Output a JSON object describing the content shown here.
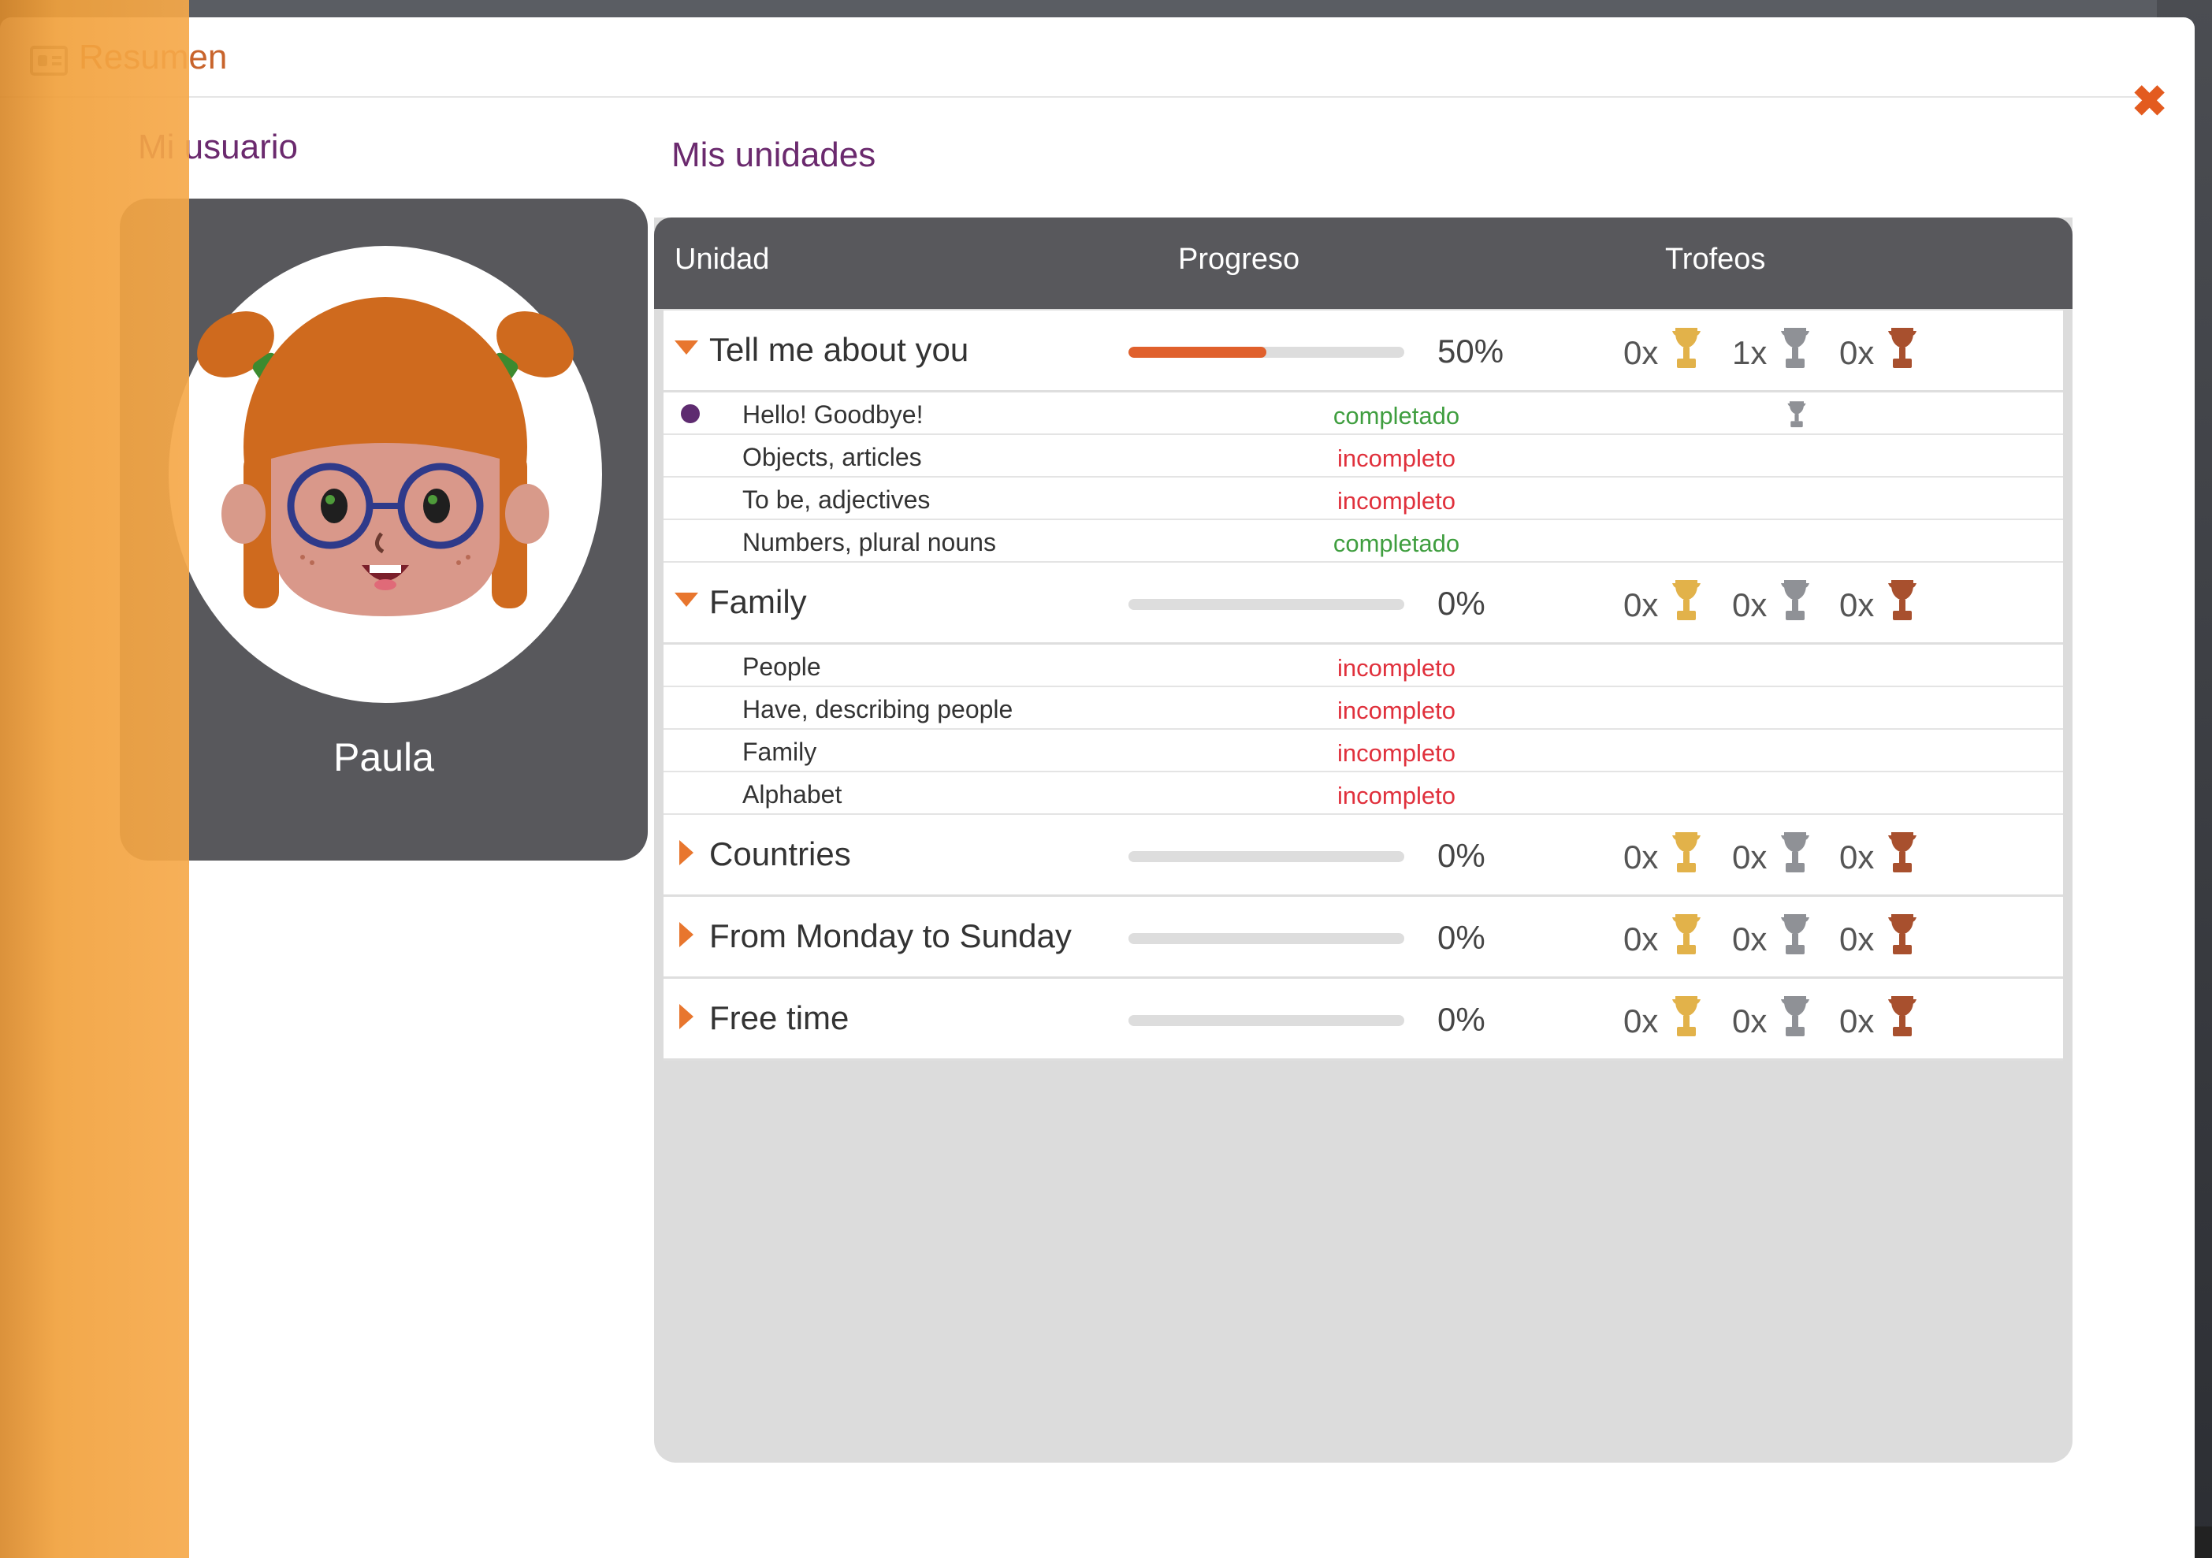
{
  "window": {
    "title": "Resumen",
    "close_symbol": "✖"
  },
  "user_section": {
    "title": "Mi usuario",
    "name": "Paula"
  },
  "units_section": {
    "title": "Mis unidades",
    "columns": {
      "unit": "Unidad",
      "progress": "Progreso",
      "trophies": "Trofeos"
    },
    "units": [
      {
        "name": "Tell me about you",
        "expanded": true,
        "progress": 50,
        "progress_label": "50%",
        "trophies": {
          "gold": "0x",
          "silver": "1x",
          "bronze": "0x"
        },
        "lessons": [
          {
            "name": "Hello! Goodbye!",
            "status": "completado",
            "current": true,
            "silver_trophy": true
          },
          {
            "name": "Objects, articles",
            "status": "incompleto"
          },
          {
            "name": "To be, adjectives",
            "status": "incompleto"
          },
          {
            "name": "Numbers, plural nouns",
            "status": "completado"
          }
        ]
      },
      {
        "name": "Family",
        "expanded": true,
        "progress": 0,
        "progress_label": "0%",
        "trophies": {
          "gold": "0x",
          "silver": "0x",
          "bronze": "0x"
        },
        "lessons": [
          {
            "name": "People",
            "status": "incompleto"
          },
          {
            "name": "Have, describing people",
            "status": "incompleto"
          },
          {
            "name": "Family",
            "status": "incompleto"
          },
          {
            "name": "Alphabet",
            "status": "incompleto"
          }
        ]
      },
      {
        "name": "Countries",
        "expanded": false,
        "progress": 0,
        "progress_label": "0%",
        "trophies": {
          "gold": "0x",
          "silver": "0x",
          "bronze": "0x"
        },
        "lessons": []
      },
      {
        "name": "From Monday to Sunday",
        "expanded": false,
        "progress": 0,
        "progress_label": "0%",
        "trophies": {
          "gold": "0x",
          "silver": "0x",
          "bronze": "0x"
        },
        "lessons": []
      },
      {
        "name": "Free time",
        "expanded": false,
        "progress": 0,
        "progress_label": "0%",
        "trophies": {
          "gold": "0x",
          "silver": "0x",
          "bronze": "0x"
        },
        "lessons": []
      }
    ]
  },
  "colors": {
    "accent_orange": "#e8762e",
    "progress_fill": "#e0602c",
    "title_purple": "#6b2a6e",
    "status_complete": "#3f9e3f",
    "status_incomplete": "#e0303c",
    "trophy_gold": "#e2b24a",
    "trophy_silver": "#8f9196",
    "trophy_bronze": "#a8502e"
  },
  "icons": {
    "header": "id-card-icon",
    "close": "close-icon",
    "expanded": "caret-down-icon",
    "collapsed": "caret-right-icon",
    "gold": "gold-trophy-icon",
    "silver": "silver-trophy-icon",
    "bronze": "bronze-trophy-icon"
  }
}
